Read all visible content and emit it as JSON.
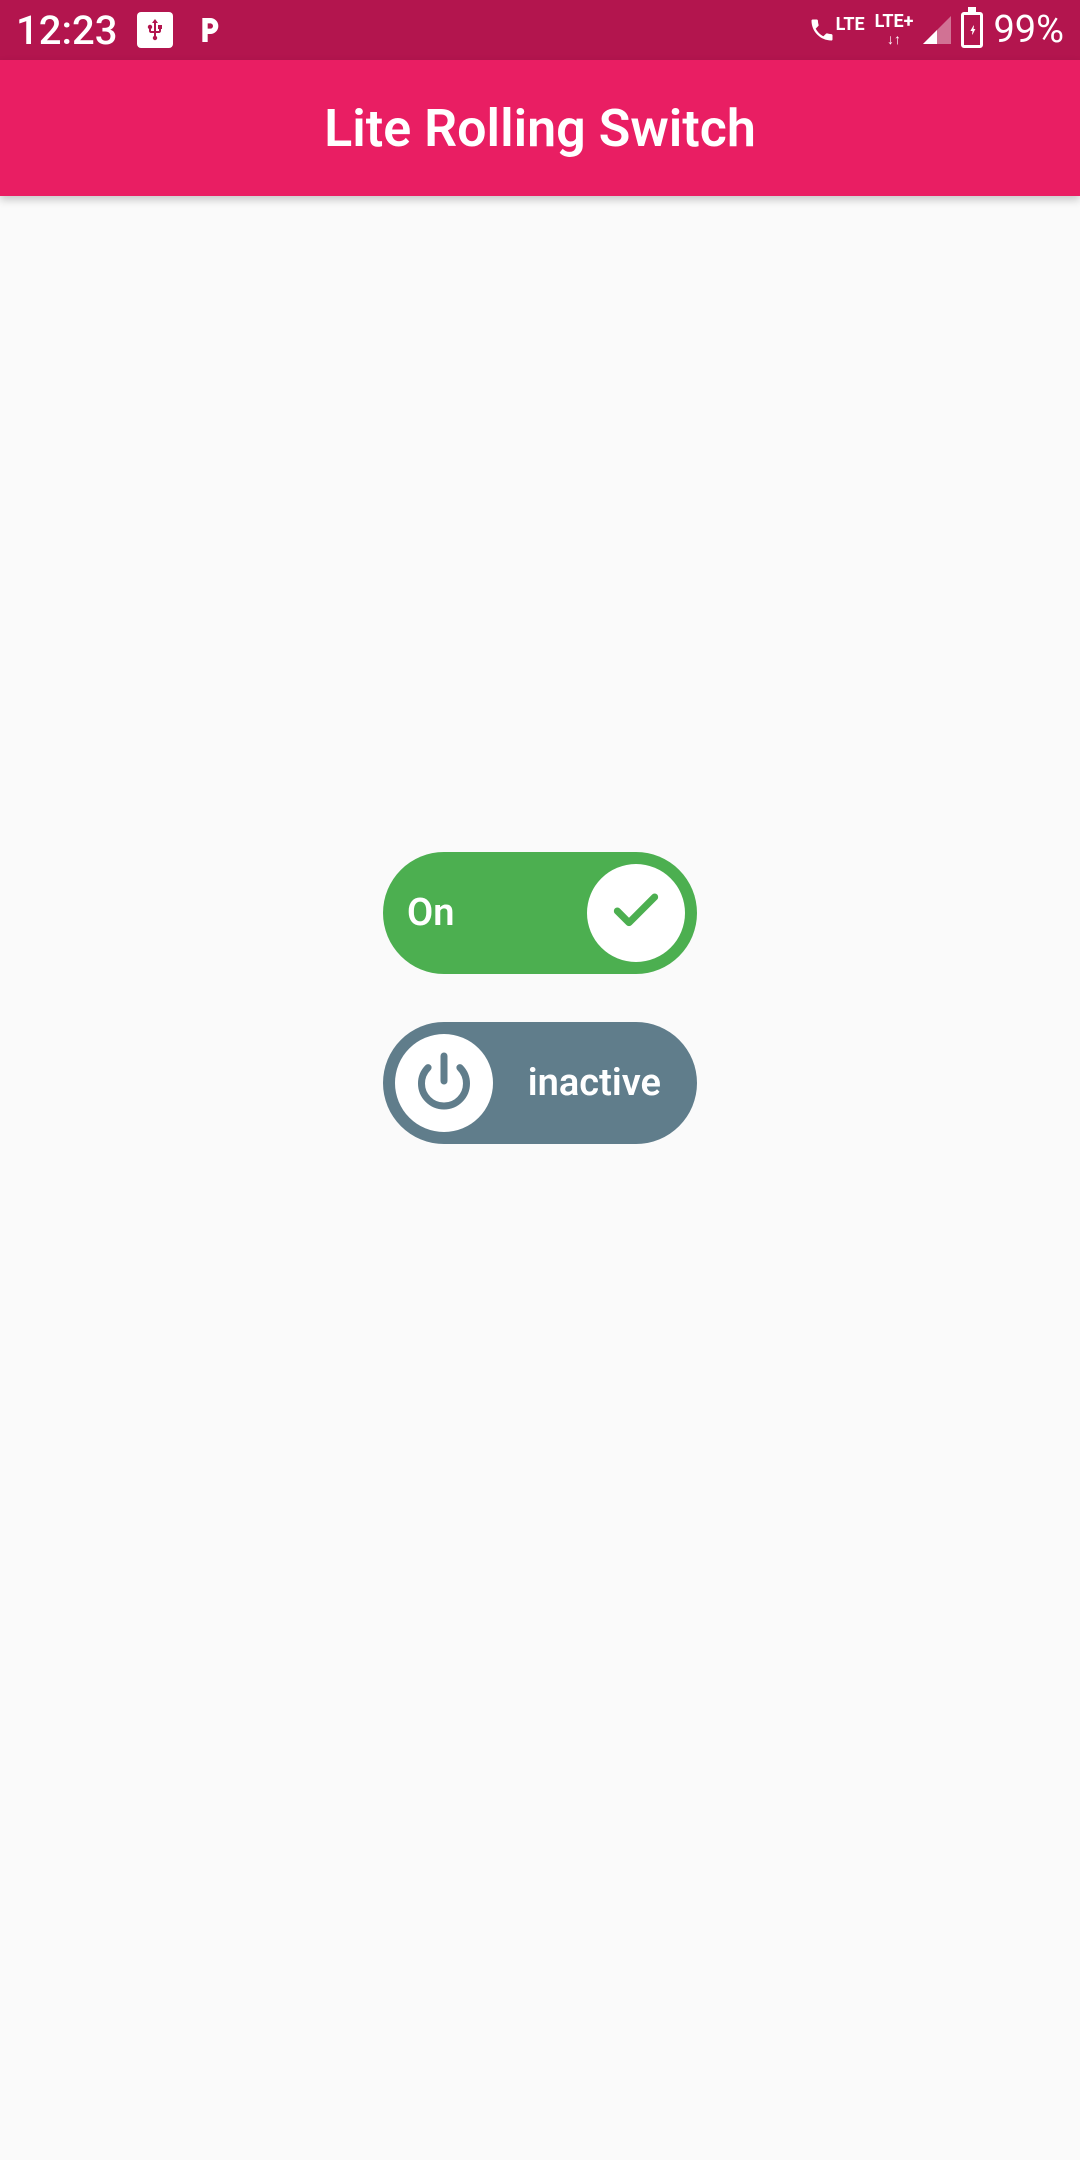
{
  "statusBar": {
    "time": "12:23",
    "lte1": "LTE",
    "lte2": "LTE+",
    "batteryPercent": "99%"
  },
  "appBar": {
    "title": "Lite Rolling Switch"
  },
  "switches": {
    "switch1": {
      "label": "On",
      "state": "on",
      "colors": {
        "bg": "#4caf50",
        "icon": "#4caf50"
      }
    },
    "switch2": {
      "label": "inactive",
      "state": "off",
      "colors": {
        "bg": "#607d8b",
        "icon": "#607d8b"
      }
    }
  }
}
